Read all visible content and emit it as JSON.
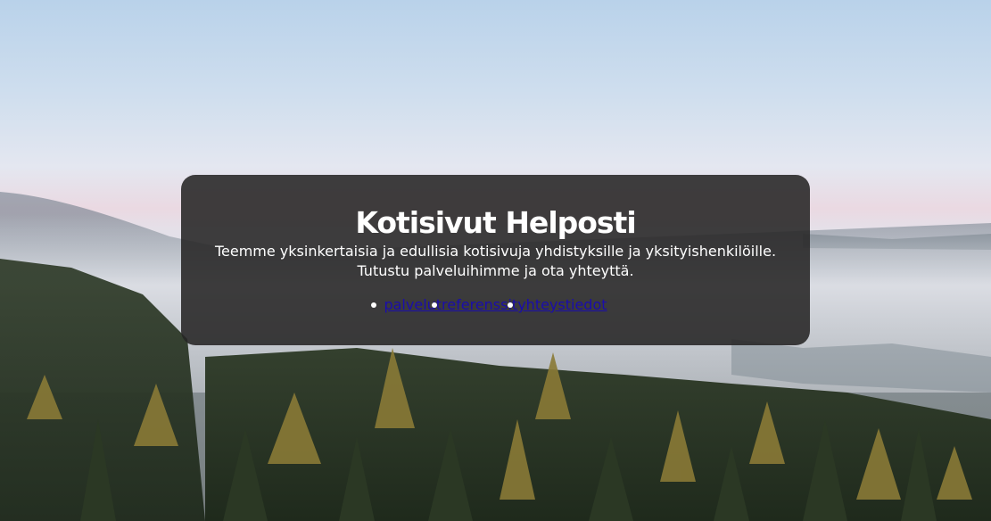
{
  "hero": {
    "title": "Kotisivut Helposti",
    "tagline_line1": "Teemme yksinkertaisia ja edullisia kotisivuja yhdistyksille ja yksityishenkilöille.",
    "tagline_line2": "Tutustu palveluihimme ja ota yhteyttä."
  },
  "nav": {
    "items": [
      {
        "label": "palvelut"
      },
      {
        "label": "referenssit"
      },
      {
        "label": "yhteystiedot"
      }
    ]
  },
  "colors": {
    "card_background": "#262424",
    "link": "#1a0dab",
    "text": "#ffffff"
  }
}
